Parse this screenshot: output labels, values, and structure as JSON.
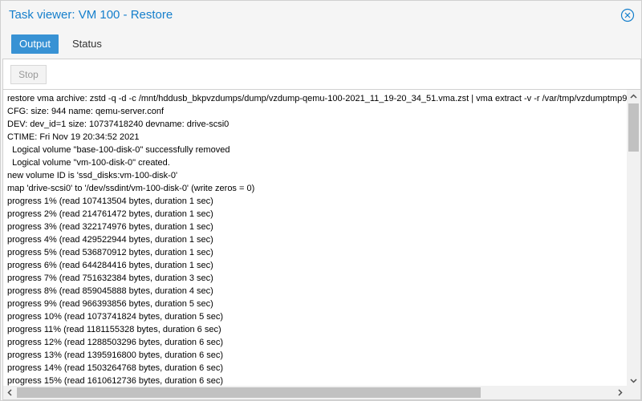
{
  "window": {
    "title": "Task viewer: VM 100 - Restore"
  },
  "tabs": [
    {
      "label": "Output",
      "active": true
    },
    {
      "label": "Status",
      "active": false
    }
  ],
  "toolbar": {
    "stop_label": "Stop"
  },
  "log_lines": [
    "restore vma archive: zstd -q -d -c /mnt/hddusb_bkpvzdumps/dump/vzdump-qemu-100-2021_11_19-20_34_51.vma.zst | vma extract -v -r /var/tmp/vzdumptmp9",
    "CFG: size: 944 name: qemu-server.conf",
    "DEV: dev_id=1 size: 10737418240 devname: drive-scsi0",
    "CTIME: Fri Nov 19 20:34:52 2021",
    "  Logical volume \"base-100-disk-0\" successfully removed",
    "  Logical volume \"vm-100-disk-0\" created.",
    "new volume ID is 'ssd_disks:vm-100-disk-0'",
    "map 'drive-scsi0' to '/dev/ssdint/vm-100-disk-0' (write zeros = 0)",
    "progress 1% (read 107413504 bytes, duration 1 sec)",
    "progress 2% (read 214761472 bytes, duration 1 sec)",
    "progress 3% (read 322174976 bytes, duration 1 sec)",
    "progress 4% (read 429522944 bytes, duration 1 sec)",
    "progress 5% (read 536870912 bytes, duration 1 sec)",
    "progress 6% (read 644284416 bytes, duration 1 sec)",
    "progress 7% (read 751632384 bytes, duration 3 sec)",
    "progress 8% (read 859045888 bytes, duration 4 sec)",
    "progress 9% (read 966393856 bytes, duration 5 sec)",
    "progress 10% (read 1073741824 bytes, duration 5 sec)",
    "progress 11% (read 1181155328 bytes, duration 6 sec)",
    "progress 12% (read 1288503296 bytes, duration 6 sec)",
    "progress 13% (read 1395916800 bytes, duration 6 sec)",
    "progress 14% (read 1503264768 bytes, duration 6 sec)",
    "progress 15% (read 1610612736 bytes, duration 6 sec)"
  ],
  "colors": {
    "accent": "#157fcc",
    "tab_active_bg": "#3892d4"
  },
  "icons": {
    "close": "close-icon",
    "scroll_up": "arrow-up-icon",
    "scroll_down": "arrow-down-icon",
    "scroll_left": "arrow-left-icon",
    "scroll_right": "arrow-right-icon"
  }
}
